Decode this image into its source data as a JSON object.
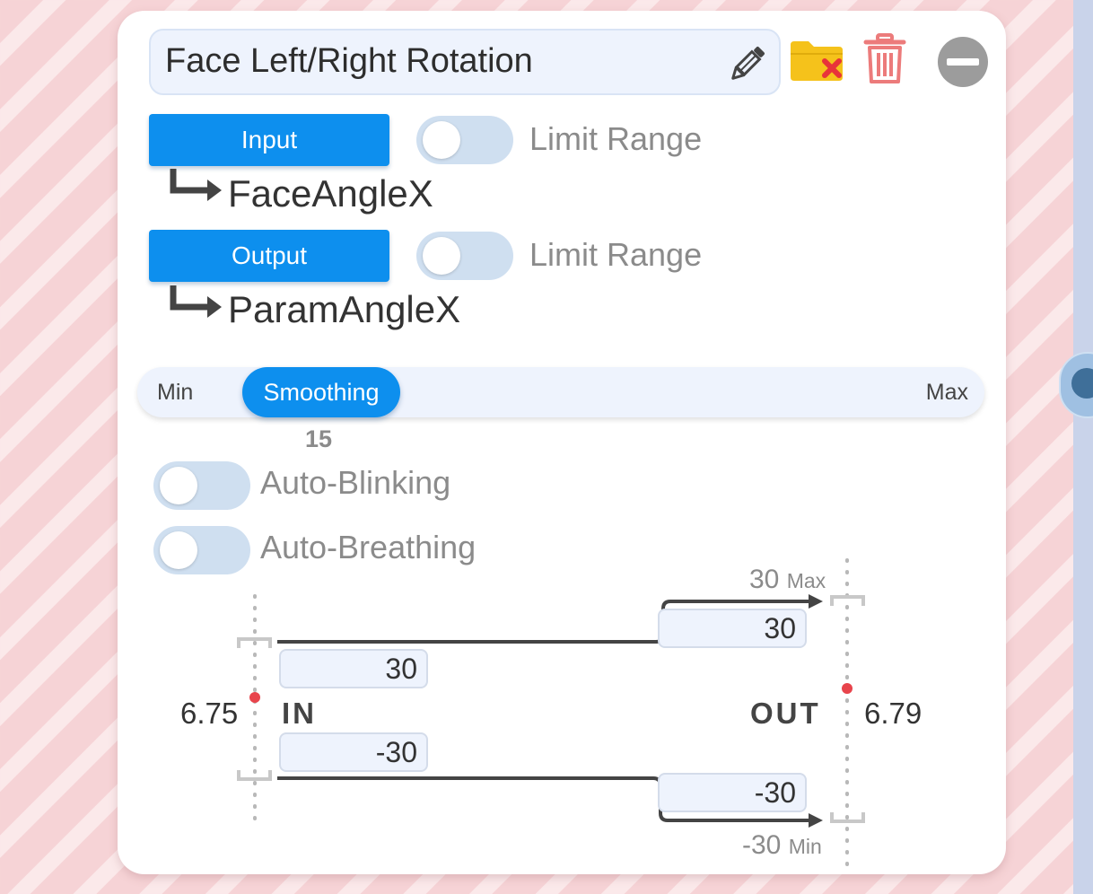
{
  "tracker": {
    "name": "Face Left/Right Rotation",
    "icons": {
      "edit": "pencil-icon",
      "folder_remove": "folder-remove-icon",
      "delete": "trash-icon",
      "collapse": "minus-circle-icon"
    }
  },
  "input": {
    "button_label": "Input",
    "limit_range_label": "Limit Range",
    "limit_range_on": false,
    "parameter": "FaceAngleX"
  },
  "output": {
    "button_label": "Output",
    "limit_range_label": "Limit Range",
    "limit_range_on": false,
    "parameter": "ParamAngleX"
  },
  "smoothing": {
    "min_label": "Min",
    "max_label": "Max",
    "thumb_label": "Smoothing",
    "value": "15"
  },
  "options": {
    "auto_blinking_label": "Auto-Blinking",
    "auto_blinking_on": false,
    "auto_breathing_label": "Auto-Breathing",
    "auto_breathing_on": false
  },
  "mapping": {
    "in_label": "IN",
    "out_label": "OUT",
    "in_current": "6.75",
    "out_current": "6.79",
    "in_max": "30",
    "in_min": "-30",
    "out_max": "30",
    "out_min": "-30",
    "out_max_caption": "30",
    "out_max_caption_unit": "Max",
    "out_min_caption": "-30",
    "out_min_caption_unit": "Min"
  },
  "colors": {
    "accent": "#0d8fee",
    "toggle_off": "#cfdff0",
    "indicator": "#e8444c",
    "folder": "#f5c21b",
    "delete": "#ec7b7b"
  }
}
